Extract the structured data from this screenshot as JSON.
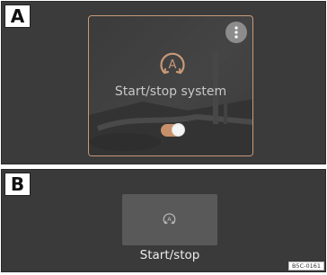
{
  "panel_a": {
    "label": "A",
    "tile": {
      "title": "Start/stop system",
      "icon": "start-stop-icon",
      "menu_icon": "more-vertical-icon",
      "toggle_on": true
    }
  },
  "panel_b": {
    "label": "B",
    "tile": {
      "title": "Start/stop",
      "icon": "start-stop-icon"
    }
  },
  "image_code": "B5C-0161",
  "colors": {
    "background": "#3b3b3b",
    "accent": "#c99978",
    "toggle_on": "#c8906a",
    "text_light": "#c8c8c8",
    "tile_b": "#595959"
  }
}
